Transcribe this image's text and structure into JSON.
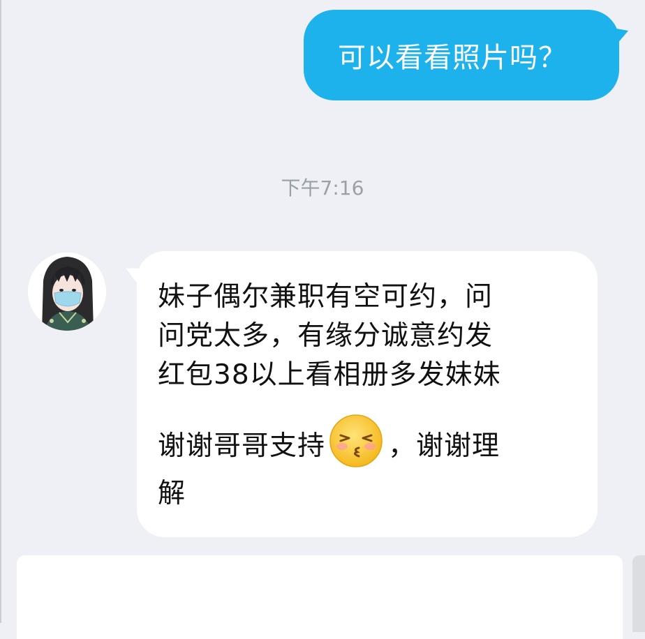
{
  "messages": {
    "outgoing": {
      "text": "可以看看照片吗？"
    },
    "timestamp": "下午7:16",
    "incoming": {
      "line1": "妹子偶尔兼职有空可约，问",
      "line2": "问党太多，有缘分诚意约发",
      "line3": "红包38以上看相册多发妹妹",
      "line4_before_emoji": "谢谢哥哥支持",
      "line4_after_emoji": "，谢谢理",
      "line5": "解",
      "emoji": "kiss-face-emoji"
    }
  },
  "colors": {
    "background": "#eef0f5",
    "outgoing_bubble": "#1eb2ec",
    "incoming_bubble": "#ffffff",
    "timestamp_text": "#9aa0a8"
  }
}
